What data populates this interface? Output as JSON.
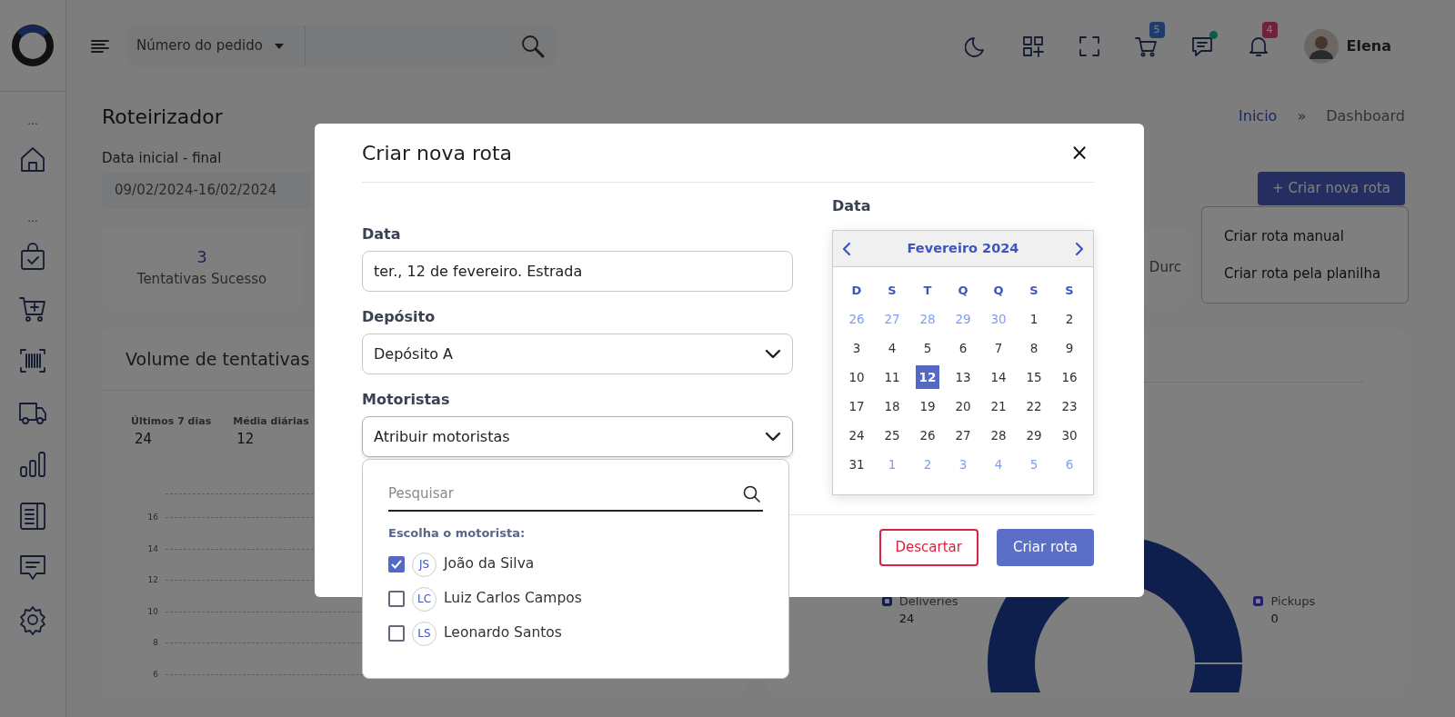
{
  "sidebar": {
    "section_marks": [
      "...",
      "..."
    ]
  },
  "topbar": {
    "search_filter": "Número do pedido",
    "cart_badge": "5",
    "chat_unread": true,
    "bell_badge": "4",
    "user_name": "Elena"
  },
  "page": {
    "title": "Roteirizador",
    "breadcrumb": [
      {
        "label": "Inicio",
        "link": true
      },
      {
        "label": "Dashboard",
        "link": false
      }
    ],
    "breadcrumb_separator": "»",
    "date_range": {
      "label": "Data inicial - final",
      "value": "09/02/2024-16/02/2024"
    },
    "create_button": "+ Criar nova rota",
    "create_menu": [
      "Criar rota manual",
      "Criar rota pela planilha"
    ],
    "stats": [
      {
        "value": "3",
        "label": "Tentativas Sucesso"
      },
      {
        "label": "Durc"
      }
    ],
    "volume_card": {
      "title": "Volume de tentativas",
      "metrics": [
        {
          "label": "Últimos 7 dias",
          "value": "24"
        },
        {
          "label": "Média diárias",
          "value": "12"
        }
      ],
      "y_axis_labels": [
        "16",
        "14",
        "12",
        "10",
        "8",
        "6"
      ]
    },
    "donut_card": {
      "legend": [
        {
          "label": "Deliveries",
          "value": "24"
        },
        {
          "label": "Pickups",
          "value": "0"
        }
      ]
    }
  },
  "modal": {
    "title": "Criar nova rota",
    "close": "×",
    "fields": [
      {
        "kind": "text",
        "label": "Data",
        "value": "ter., 12 de fevereiro. Estrada"
      },
      {
        "kind": "select",
        "label": "Depósito",
        "value": "Depósito A",
        "expanded": false
      },
      {
        "kind": "select",
        "label": "Motoristas",
        "value": "Atribuir motoristas",
        "expanded": true
      }
    ],
    "driver_picker": {
      "search_placeholder": "Pesquisar",
      "heading": "Escolha o motorista:",
      "drivers": [
        {
          "initials": "JS",
          "name": "João da Silva",
          "checked": true
        },
        {
          "initials": "LC",
          "name": "Luiz Carlos Campos",
          "checked": false
        },
        {
          "initials": "LS",
          "name": "Leonardo Santos",
          "checked": false
        }
      ]
    },
    "calendar": {
      "label": "Data",
      "month": "Fevereiro 2024",
      "weekdays": [
        "D",
        "S",
        "T",
        "Q",
        "Q",
        "S",
        "S"
      ],
      "weeks": [
        [
          {
            "day": "26",
            "outside": true,
            "selected": false
          },
          {
            "day": "27",
            "outside": true,
            "selected": false
          },
          {
            "day": "28",
            "outside": true,
            "selected": false
          },
          {
            "day": "29",
            "outside": true,
            "selected": false
          },
          {
            "day": "30",
            "outside": true,
            "selected": false
          },
          {
            "day": "1",
            "outside": false,
            "selected": false
          },
          {
            "day": "2",
            "outside": false,
            "selected": false
          }
        ],
        [
          {
            "day": "3",
            "outside": false,
            "selected": false
          },
          {
            "day": "4",
            "outside": false,
            "selected": false
          },
          {
            "day": "5",
            "outside": false,
            "selected": false
          },
          {
            "day": "6",
            "outside": false,
            "selected": false
          },
          {
            "day": "7",
            "outside": false,
            "selected": false
          },
          {
            "day": "8",
            "outside": false,
            "selected": false
          },
          {
            "day": "9",
            "outside": false,
            "selected": false
          }
        ],
        [
          {
            "day": "10",
            "outside": false,
            "selected": false
          },
          {
            "day": "11",
            "outside": false,
            "selected": false
          },
          {
            "day": "12",
            "outside": false,
            "selected": true
          },
          {
            "day": "13",
            "outside": false,
            "selected": false
          },
          {
            "day": "14",
            "outside": false,
            "selected": false
          },
          {
            "day": "15",
            "outside": false,
            "selected": false
          },
          {
            "day": "16",
            "outside": false,
            "selected": false
          }
        ],
        [
          {
            "day": "17",
            "outside": false,
            "selected": false
          },
          {
            "day": "18",
            "outside": false,
            "selected": false
          },
          {
            "day": "19",
            "outside": false,
            "selected": false
          },
          {
            "day": "20",
            "outside": false,
            "selected": false
          },
          {
            "day": "21",
            "outside": false,
            "selected": false
          },
          {
            "day": "22",
            "outside": false,
            "selected": false
          },
          {
            "day": "23",
            "outside": false,
            "selected": false
          }
        ],
        [
          {
            "day": "24",
            "outside": false,
            "selected": false
          },
          {
            "day": "25",
            "outside": false,
            "selected": false
          },
          {
            "day": "26",
            "outside": false,
            "selected": false
          },
          {
            "day": "27",
            "outside": false,
            "selected": false
          },
          {
            "day": "28",
            "outside": false,
            "selected": false
          },
          {
            "day": "29",
            "outside": false,
            "selected": false
          },
          {
            "day": "30",
            "outside": false,
            "selected": false
          }
        ],
        [
          {
            "day": "31",
            "outside": false,
            "selected": false
          },
          {
            "day": "1",
            "outside": true,
            "selected": false
          },
          {
            "day": "2",
            "outside": true,
            "selected": false
          },
          {
            "day": "3",
            "outside": true,
            "selected": false
          },
          {
            "day": "4",
            "outside": true,
            "selected": false
          },
          {
            "day": "5",
            "outside": true,
            "selected": false
          },
          {
            "day": "6",
            "outside": true,
            "selected": false
          }
        ]
      ]
    },
    "discard_button": "Descartar",
    "submit_button": "Criar rota"
  }
}
